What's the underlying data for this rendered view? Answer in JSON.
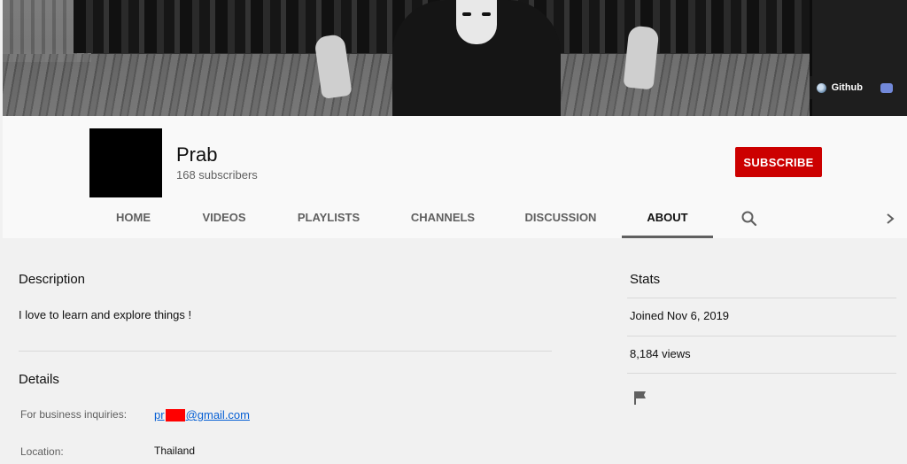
{
  "banner": {
    "links": [
      {
        "label": "Github",
        "icon": "globe-icon"
      },
      {
        "label": "",
        "icon": "discord-icon"
      }
    ]
  },
  "channel": {
    "name": "Prab",
    "subscribers": "168 subscribers",
    "subscribe_label": "SUBSCRIBE"
  },
  "tabs": [
    {
      "label": "HOME"
    },
    {
      "label": "VIDEOS"
    },
    {
      "label": "PLAYLISTS"
    },
    {
      "label": "CHANNELS"
    },
    {
      "label": "DISCUSSION"
    },
    {
      "label": "ABOUT",
      "active": true
    }
  ],
  "about": {
    "description_heading": "Description",
    "description": "I love to learn and explore things !",
    "details_heading": "Details",
    "business_label": "For business inquiries:",
    "email_prefix": "pr",
    "email_suffix": "@gmail.com",
    "location_label": "Location:",
    "location_value": "Thailand"
  },
  "stats": {
    "heading": "Stats",
    "joined": "Joined Nov 6, 2019",
    "views": "8,184 views"
  },
  "colors": {
    "subscribe": "#cc0000",
    "link": "#065fd4",
    "redaction": "#ff0000"
  }
}
